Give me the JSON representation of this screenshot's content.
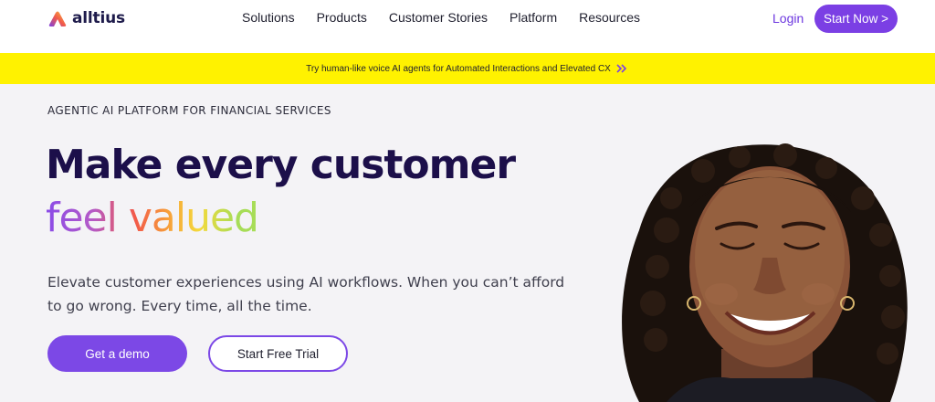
{
  "nav": {
    "logo_text": "alltius",
    "links": [
      "Solutions",
      "Products",
      "Customer Stories",
      "Platform",
      "Resources"
    ],
    "login_label": "Login",
    "cta_label": "Start Now >"
  },
  "banner": {
    "text": "Try human-like voice AI agents for Automated Interactions and Elevated CX",
    "icon": "double-chevron-right-icon"
  },
  "hero": {
    "eyebrow": "AGENTIC AI PLATFORM FOR FINANCIAL SERVICES",
    "headline_line1": "Make every customer",
    "headline_line2": "feel valued",
    "subhead": "Elevate customer experiences using AI workflows. When you can’t afford to go wrong. Every time, all the time.",
    "primary_button": "Get a demo",
    "secondary_button": "Start Free Trial"
  },
  "colors": {
    "brand_purple": "#7b3fe4",
    "headline_navy": "#1c0f4a",
    "banner_yellow": "#fff200",
    "hero_background": "#f4f3f6"
  }
}
